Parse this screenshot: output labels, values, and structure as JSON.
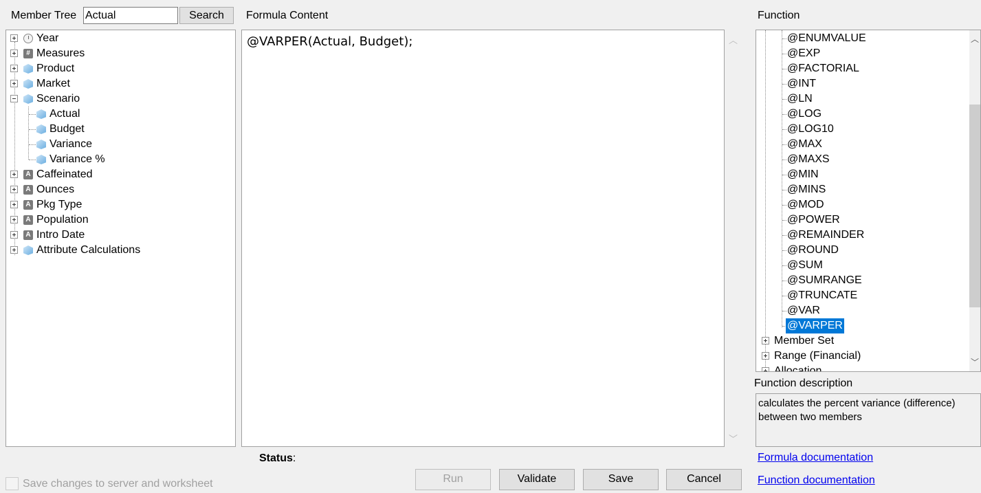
{
  "member_tree": {
    "label": "Member Tree",
    "search_value": "Actual",
    "search_button": "Search",
    "items": [
      {
        "label": "Year",
        "icon": "clock-icon",
        "expander": "plus",
        "level": 0
      },
      {
        "label": "Measures",
        "icon": "hash-icon",
        "expander": "plus",
        "level": 0
      },
      {
        "label": "Product",
        "icon": "cube-icon",
        "expander": "plus",
        "level": 0
      },
      {
        "label": "Market",
        "icon": "cube-icon",
        "expander": "plus",
        "level": 0
      },
      {
        "label": "Scenario",
        "icon": "cube-icon",
        "expander": "minus",
        "level": 0
      },
      {
        "label": "Actual",
        "icon": "cube-icon",
        "level": 1
      },
      {
        "label": "Budget",
        "icon": "cube-icon",
        "level": 1
      },
      {
        "label": "Variance",
        "icon": "cube-icon",
        "level": 1
      },
      {
        "label": "Variance %",
        "icon": "cube-icon",
        "level": 1
      },
      {
        "label": "Caffeinated",
        "icon": "attribute-icon",
        "expander": "plus",
        "level": 0
      },
      {
        "label": "Ounces",
        "icon": "attribute-icon",
        "expander": "plus",
        "level": 0
      },
      {
        "label": "Pkg Type",
        "icon": "attribute-icon",
        "expander": "plus",
        "level": 0
      },
      {
        "label": "Population",
        "icon": "attribute-icon",
        "expander": "plus",
        "level": 0
      },
      {
        "label": "Intro Date",
        "icon": "attribute-icon",
        "expander": "plus",
        "level": 0
      },
      {
        "label": "Attribute Calculations",
        "icon": "cube-icon",
        "expander": "plus",
        "level": 0
      }
    ]
  },
  "formula": {
    "label": "Formula Content",
    "content": "@VARPER(Actual, Budget);"
  },
  "function": {
    "label": "Function",
    "items": [
      "@ENUMVALUE",
      "@EXP",
      "@FACTORIAL",
      "@INT",
      "@LN",
      "@LOG",
      "@LOG10",
      "@MAX",
      "@MAXS",
      "@MIN",
      "@MINS",
      "@MOD",
      "@POWER",
      "@REMAINDER",
      "@ROUND",
      "@SUM",
      "@SUMRANGE",
      "@TRUNCATE",
      "@VAR",
      "@VARPER"
    ],
    "selected": "@VARPER",
    "groups": [
      "Member Set",
      "Range (Financial)",
      "Allocation"
    ],
    "description_label": "Function description",
    "description": "calculates the percent variance (difference) between two members",
    "formula_doc_link": "Formula documentation",
    "function_doc_link": "Function documentation"
  },
  "status_label": "Status",
  "save_checkbox": "Save changes to server and worksheet",
  "buttons": {
    "run": "Run",
    "validate": "Validate",
    "save": "Save",
    "cancel": "Cancel"
  },
  "colors": {
    "selection": "#0078d7",
    "link": "#0000ee"
  }
}
